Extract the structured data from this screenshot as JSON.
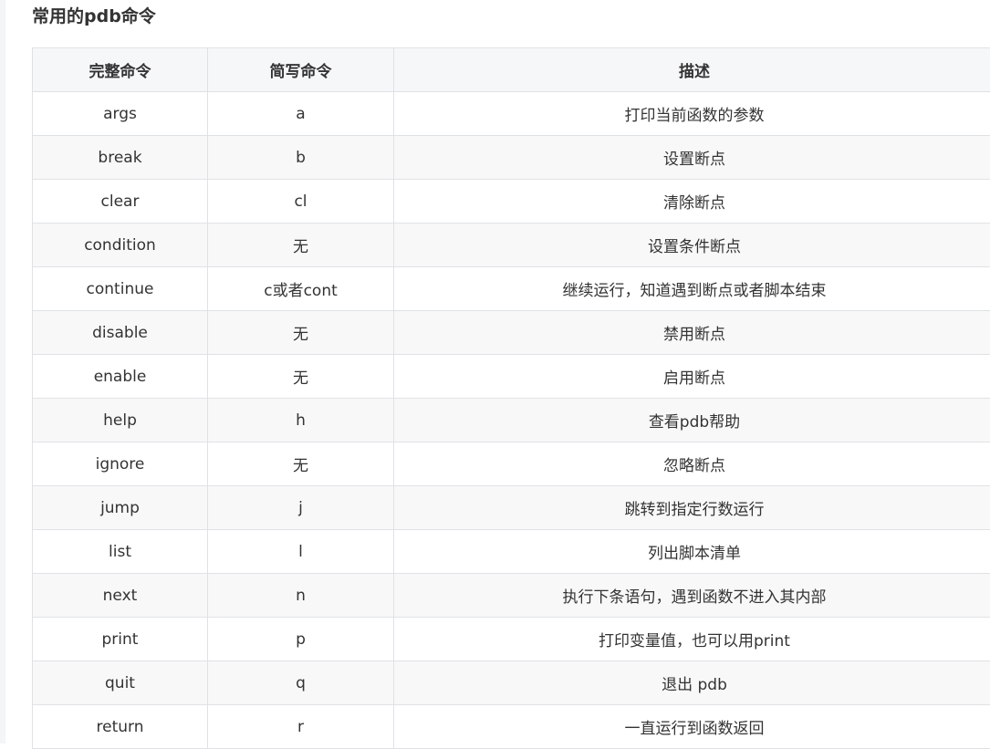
{
  "heading": "常用的pdb命令",
  "table": {
    "headers": [
      "完整命令",
      "简写命令",
      "描述"
    ],
    "rows": [
      [
        "args",
        "a",
        "打印当前函数的参数"
      ],
      [
        "break",
        "b",
        "设置断点"
      ],
      [
        "clear",
        "cl",
        "清除断点"
      ],
      [
        "condition",
        "无",
        "设置条件断点"
      ],
      [
        "continue",
        "c或者cont",
        "继续运行，知道遇到断点或者脚本结束"
      ],
      [
        "disable",
        "无",
        "禁用断点"
      ],
      [
        "enable",
        "无",
        "启用断点"
      ],
      [
        "help",
        "h",
        "查看pdb帮助"
      ],
      [
        "ignore",
        "无",
        "忽略断点"
      ],
      [
        "jump",
        "j",
        "跳转到指定行数运行"
      ],
      [
        "list",
        "l",
        "列出脚本清单"
      ],
      [
        "next",
        "n",
        "执行下条语句，遇到函数不进入其内部"
      ],
      [
        "print",
        "p",
        "打印变量值，也可以用print"
      ],
      [
        "quit",
        "q",
        "退出 pdb"
      ],
      [
        "return",
        "r",
        "一直运行到函数返回"
      ]
    ]
  }
}
